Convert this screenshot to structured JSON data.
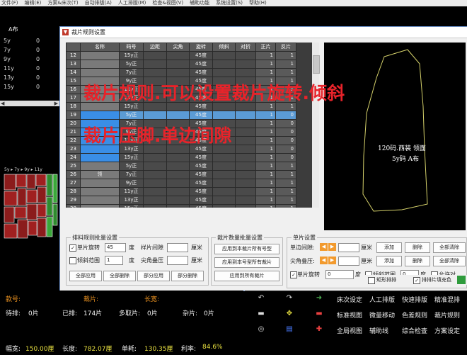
{
  "menubar": {
    "items": [
      "文件(F)",
      "编辑(E)",
      "方案&床次(T)",
      "自动排版(A)",
      "人工排版(M)",
      "检查&视图(V)",
      "辅助功能",
      "系统设置(S)",
      "帮助(H)"
    ]
  },
  "left_panel": {
    "title": "A布",
    "rows": [
      {
        "size": "5y",
        "count": "0"
      },
      {
        "size": "7y",
        "count": "0"
      },
      {
        "size": "9y",
        "count": "0"
      },
      {
        "size": "11y",
        "count": "0"
      },
      {
        "size": "13y",
        "count": "0"
      },
      {
        "size": "15y",
        "count": "0"
      }
    ],
    "scroll_left": "◀",
    "scroll_right": "▶",
    "mini_header": "5y ▸ 7y ▸ 9y ▸ 11y"
  },
  "dialog": {
    "title": "裁片规则设置",
    "grid": {
      "headers": [
        "名称",
        "码号",
        "边距",
        "尖角",
        "旋转",
        "倾斜",
        "对折",
        "正片",
        "反片"
      ],
      "rows": [
        {
          "n": "12",
          "size": "15y正",
          "rot": "45度",
          "pos": "1",
          "neg": "1",
          "name": "",
          "hl": false
        },
        {
          "n": "13",
          "size": "5y正",
          "rot": "45度",
          "pos": "1",
          "neg": "1",
          "name": "",
          "hl": false
        },
        {
          "n": "14",
          "size": "7y正",
          "rot": "45度",
          "pos": "1",
          "neg": "1",
          "name": "",
          "hl": false
        },
        {
          "n": "15",
          "size": "9y正",
          "rot": "45度",
          "pos": "1",
          "neg": "1",
          "name": "",
          "hl": false
        },
        {
          "n": "16",
          "size": "11y正",
          "rot": "45度",
          "pos": "1",
          "neg": "1",
          "name": "",
          "hl": false
        },
        {
          "n": "17",
          "size": "13y正",
          "rot": "45度",
          "pos": "1",
          "neg": "1",
          "name": "",
          "hl": false
        },
        {
          "n": "18",
          "size": "15y正",
          "rot": "45度",
          "pos": "1",
          "neg": "1",
          "name": "",
          "hl": false
        },
        {
          "n": "19",
          "size": "5y正",
          "rot": "45度",
          "pos": "1",
          "neg": "0",
          "name": "",
          "hl": true
        },
        {
          "n": "20",
          "size": "7y正",
          "rot": "45度",
          "pos": "1",
          "neg": "0",
          "name": "",
          "hl": false
        },
        {
          "n": "21",
          "size": "9y正",
          "rot": "45度",
          "pos": "1",
          "neg": "0",
          "name": "",
          "hl": false
        },
        {
          "n": "22",
          "size": "11y正",
          "rot": "45度",
          "pos": "1",
          "neg": "0",
          "name": "",
          "hl": false
        },
        {
          "n": "23",
          "size": "13y正",
          "rot": "45度",
          "pos": "1",
          "neg": "0",
          "name": "",
          "hl": false
        },
        {
          "n": "24",
          "size": "15y正",
          "rot": "45度",
          "pos": "1",
          "neg": "0",
          "name": "",
          "hl": false
        },
        {
          "n": "25",
          "size": "5y正",
          "rot": "45度",
          "pos": "1",
          "neg": "1",
          "name": "",
          "hl": false
        },
        {
          "n": "26",
          "size": "7y正",
          "rot": "45度",
          "pos": "1",
          "neg": "1",
          "name": "领",
          "hl": false
        },
        {
          "n": "27",
          "size": "9y正",
          "rot": "45度",
          "pos": "1",
          "neg": "1",
          "name": "",
          "hl": false
        },
        {
          "n": "28",
          "size": "11y正",
          "rot": "45度",
          "pos": "1",
          "neg": "1",
          "name": "",
          "hl": false
        },
        {
          "n": "29",
          "size": "13y正",
          "rot": "45度",
          "pos": "1",
          "neg": "1",
          "name": "",
          "hl": false
        },
        {
          "n": "30",
          "size": "15y正",
          "rot": "45度",
          "pos": "1",
          "neg": "1",
          "name": "",
          "hl": false
        }
      ]
    },
    "preview": {
      "line1": "120码.西装 领面",
      "line2": "5y码 A布"
    },
    "batch_group": {
      "title": "排料规则批量设置",
      "single_rotate_label": "单片旋转",
      "single_rotate_value": "45",
      "deg": "度",
      "sample_gap_label": "样片间隙",
      "cm": "厘米",
      "tilt_range_label": "倾斜范围",
      "tilt_value": "1",
      "tip_overlap_label": "尖角叠压",
      "buttons": [
        "全部应用",
        "全部删除",
        "部分应用",
        "部分删除"
      ]
    },
    "qty_group": {
      "title": "裁片数量批量设置",
      "buttons": [
        "应用到本裁片所有号型",
        "应用到本号型所有裁片",
        "应用到所有裁片"
      ]
    },
    "single_group": {
      "title": "单片设置",
      "single_gap_label": "单边间隙:",
      "tip_overlap_label": "尖角叠压:",
      "cm": "厘米",
      "add": "添加",
      "delete": "删除",
      "delete_all": "全部清除",
      "single_rotate_label": "单片旋转",
      "rotate_value": "0",
      "deg": "度",
      "tilt_label": "倾斜范围",
      "tilt_value": "0",
      "allow_fold": "允许对"
    },
    "check_rect": "矩形排排",
    "check_fill": "排排片填充色"
  },
  "overlay": {
    "line1": "裁片规则.可以设置裁片旋转.倾斜",
    "line2": "裁片压脚.单边间隙"
  },
  "status": {
    "row1": [
      {
        "label": "款号:",
        "value": ""
      },
      {
        "label": "裁片:",
        "value": ""
      },
      {
        "label": "长宽:",
        "value": ""
      }
    ],
    "row2": [
      {
        "label": "待排:",
        "value": "0片"
      },
      {
        "label": "已排:",
        "value": "174片"
      },
      {
        "label": "多取片:",
        "value": "0片"
      },
      {
        "label": "杂片:",
        "value": "0片"
      }
    ],
    "row3": [
      {
        "label": "幅宽:",
        "value": "150.00厘"
      },
      {
        "label": "长度:",
        "value": "782.07厘"
      },
      {
        "label": "单耗:",
        "value": "130.35厘"
      },
      {
        "label": "利率:",
        "value": "84.6%"
      }
    ]
  },
  "toolbar": {
    "labels": [
      [
        "床次设定",
        "人工排版",
        "快速排版",
        "精准混排"
      ],
      [
        "标准视图",
        "微量移动",
        "色差规则",
        "裁片规则"
      ],
      [
        "全局视图",
        "辅助线",
        "综合检查",
        "方案设定"
      ]
    ]
  },
  "colors": {
    "accent_blue": "#3a8ee6",
    "overlay_red": "#e8232a",
    "status_label_orange": "#e89020",
    "status_value_yellow": "#e8e040",
    "arrow_orange": "#f29a2e",
    "preview_outline": "#d4d06a"
  }
}
